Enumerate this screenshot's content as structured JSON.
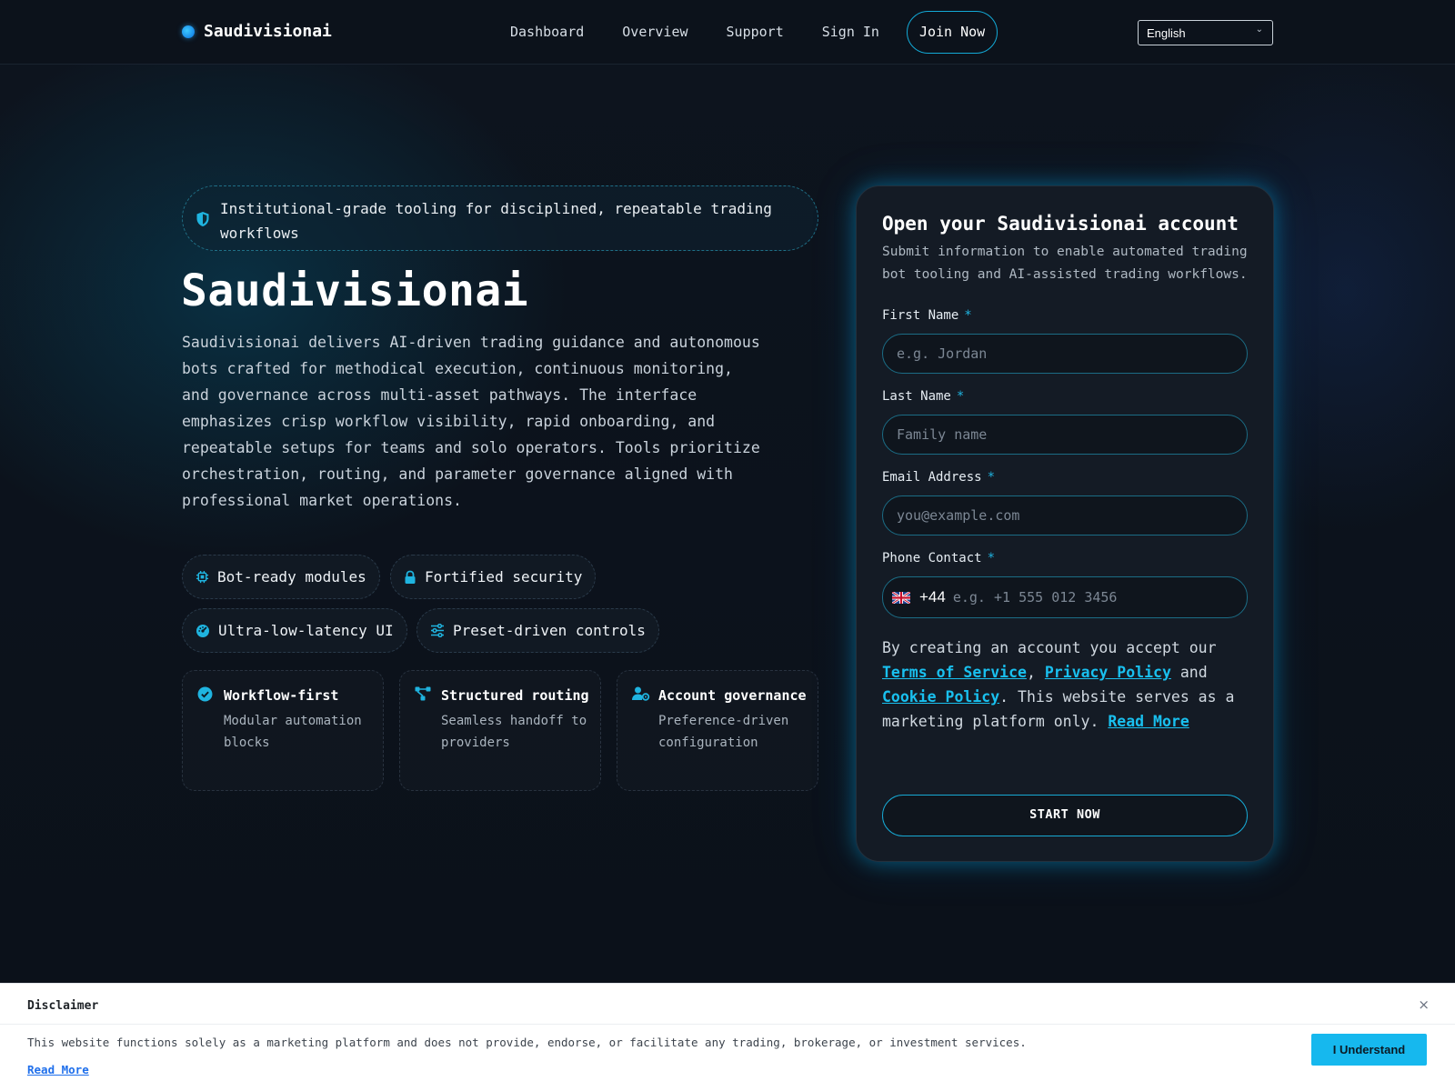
{
  "header": {
    "brand": "Saudivisionai",
    "nav": [
      "Dashboard",
      "Overview",
      "Support",
      "Sign In"
    ],
    "join_label": "Join Now",
    "language": "English"
  },
  "hero": {
    "tagline": "Institutional-grade tooling for disciplined, repeatable trading workflows",
    "title": "Saudivisionai",
    "description": "Saudivisionai delivers AI-driven trading guidance and autonomous bots crafted for methodical execution, continuous monitoring, and governance across multi-asset pathways. The interface emphasizes crisp workflow visibility, rapid onboarding, and repeatable setups for teams and solo operators. Tools prioritize orchestration, routing, and parameter governance aligned with professional market operations.",
    "chips": [
      "Bot-ready modules",
      "Fortified security",
      "Ultra-low-latency UI",
      "Preset-driven controls"
    ],
    "features": [
      {
        "title": "Workflow-first",
        "subtitle": "Modular automation blocks"
      },
      {
        "title": "Structured routing",
        "subtitle": "Seamless handoff to providers"
      },
      {
        "title": "Account governance",
        "subtitle": "Preference-driven configuration"
      }
    ]
  },
  "form": {
    "title": "Open your Saudivisionai account",
    "subtitle": "Submit information to enable automated trading bot tooling and AI-assisted trading workflows.",
    "required_mark": "*",
    "fields": {
      "first_name": {
        "label": "First Name",
        "placeholder": "e.g. Jordan"
      },
      "last_name": {
        "label": "Last Name",
        "placeholder": "Family name"
      },
      "email": {
        "label": "Email Address",
        "placeholder": "you@example.com"
      },
      "phone": {
        "label": "Phone Contact",
        "dial_code": "+44",
        "placeholder": "e.g. +1 555 012 3456"
      }
    },
    "consent": {
      "prefix": "By creating an account you accept our ",
      "terms": "Terms of Service",
      "sep1": ", ",
      "privacy": "Privacy Policy",
      "sep2": " and ",
      "cookie": "Cookie Policy",
      "middle": ". This website serves as a marketing platform only. ",
      "read_more": "Read More"
    },
    "submit_label": "START NOW"
  },
  "disclaimer": {
    "title": "Disclaimer",
    "close": "×",
    "text": "This website functions solely as a marketing platform and does not provide, endorse, or facilitate any trading, brokerage, or investment services.",
    "read_more": "Read More",
    "button": "I Understand"
  },
  "colors": {
    "accent": "#1fb4e0",
    "background": "#0b111a",
    "card": "#141b25"
  }
}
